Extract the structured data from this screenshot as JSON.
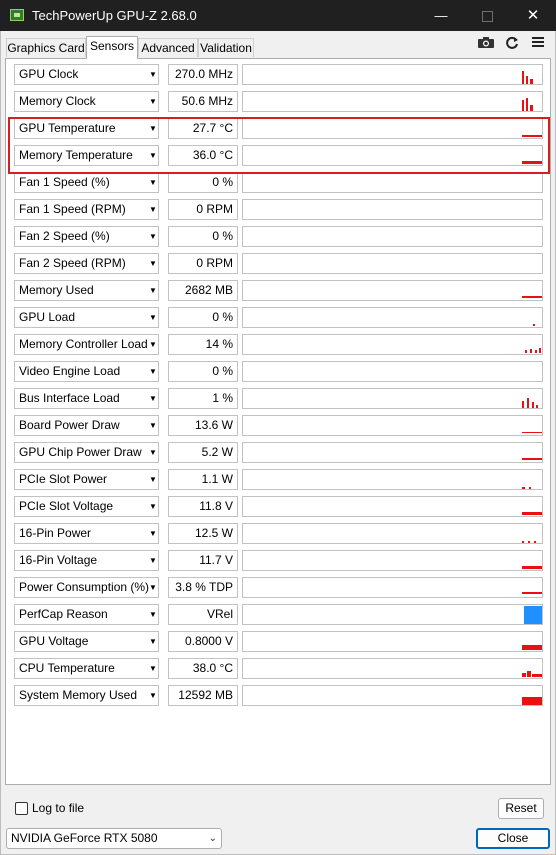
{
  "window": {
    "title": "TechPowerUp GPU-Z 2.68.0"
  },
  "tabs": [
    {
      "label": "Graphics Card"
    },
    {
      "label": "Sensors"
    },
    {
      "label": "Advanced"
    },
    {
      "label": "Validation"
    }
  ],
  "active_tab": "Sensors",
  "toolbar_icons": [
    "camera-icon",
    "refresh-icon",
    "menu-icon"
  ],
  "colors": {
    "graph": "#e81010",
    "perfcap": "#1e90ff",
    "highlight": "#d62020",
    "titlebar": "#202020"
  },
  "sensors": [
    {
      "name": "GPU Clock",
      "value": "270.0 MHz"
    },
    {
      "name": "Memory Clock",
      "value": "50.6 MHz"
    },
    {
      "name": "GPU Temperature",
      "value": "27.7 °C"
    },
    {
      "name": "Memory Temperature",
      "value": "36.0 °C"
    },
    {
      "name": "Fan 1 Speed (%)",
      "value": "0 %"
    },
    {
      "name": "Fan 1 Speed (RPM)",
      "value": "0 RPM"
    },
    {
      "name": "Fan 2 Speed (%)",
      "value": "0 %"
    },
    {
      "name": "Fan 2 Speed (RPM)",
      "value": "0 RPM"
    },
    {
      "name": "Memory Used",
      "value": "2682 MB"
    },
    {
      "name": "GPU Load",
      "value": "0 %"
    },
    {
      "name": "Memory Controller Load",
      "value": "14 %"
    },
    {
      "name": "Video Engine Load",
      "value": "0 %"
    },
    {
      "name": "Bus Interface Load",
      "value": "1 %"
    },
    {
      "name": "Board Power Draw",
      "value": "13.6 W"
    },
    {
      "name": "GPU Chip Power Draw",
      "value": "5.2 W"
    },
    {
      "name": "PCIe Slot Power",
      "value": "1.1 W"
    },
    {
      "name": "PCIe Slot Voltage",
      "value": "11.8 V"
    },
    {
      "name": "16-Pin Power",
      "value": "12.5 W"
    },
    {
      "name": "16-Pin Voltage",
      "value": "11.7 V"
    },
    {
      "name": "Power Consumption (%)",
      "value": "3.8 % TDP"
    },
    {
      "name": "PerfCap Reason",
      "value": "VRel"
    },
    {
      "name": "GPU Voltage",
      "value": "0.8000 V"
    },
    {
      "name": "CPU Temperature",
      "value": "38.0 °C"
    },
    {
      "name": "System Memory Used",
      "value": "12592 MB"
    }
  ],
  "footer": {
    "log_to_file_label": "Log to file",
    "log_to_file_checked": false,
    "reset_label": "Reset",
    "gpu_selected": "NVIDIA GeForce RTX 5080",
    "close_label": "Close"
  }
}
